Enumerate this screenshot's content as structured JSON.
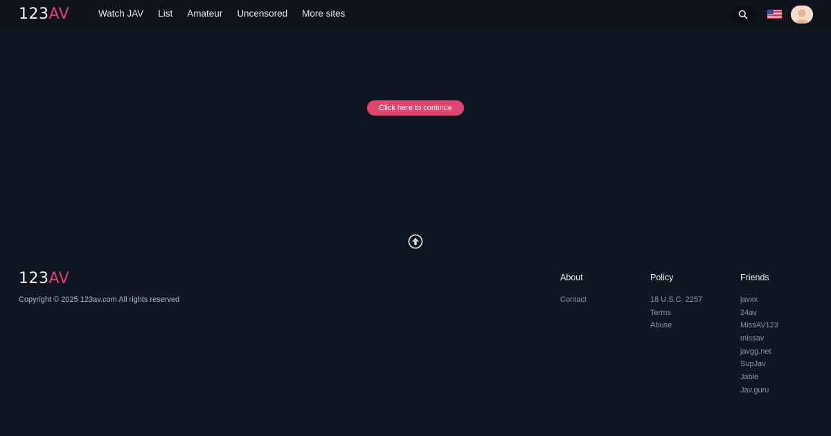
{
  "header": {
    "logo": {
      "part1": "123",
      "part2": "AV"
    },
    "nav": [
      "Watch JAV",
      "List",
      "Amateur",
      "Uncensored",
      "More sites"
    ],
    "icons": {
      "search": "search-icon",
      "flag": "us-flag-icon",
      "avatar": "user-avatar"
    }
  },
  "main": {
    "continue_label": "Click here to continue",
    "scroll_top_icon": "arrow-up-circle-icon"
  },
  "footer": {
    "logo": {
      "part1": "123",
      "part2": "AV"
    },
    "copyright": "Copyright © 2025 123av.com All rights reserved",
    "columns": [
      {
        "title": "About",
        "links": [
          "Contact"
        ]
      },
      {
        "title": "Policy",
        "links": [
          "18 U.S.C. 2257",
          "Terms",
          "Abuse"
        ]
      },
      {
        "title": "Friends",
        "links": [
          "javxx",
          "24av",
          "MissAV123",
          "missav",
          "javgg.net",
          "SupJav",
          "Jable",
          "Jav.guru"
        ]
      }
    ]
  },
  "colors": {
    "background": "#111722",
    "header": "#0e131c",
    "accent": "#e0456f"
  }
}
